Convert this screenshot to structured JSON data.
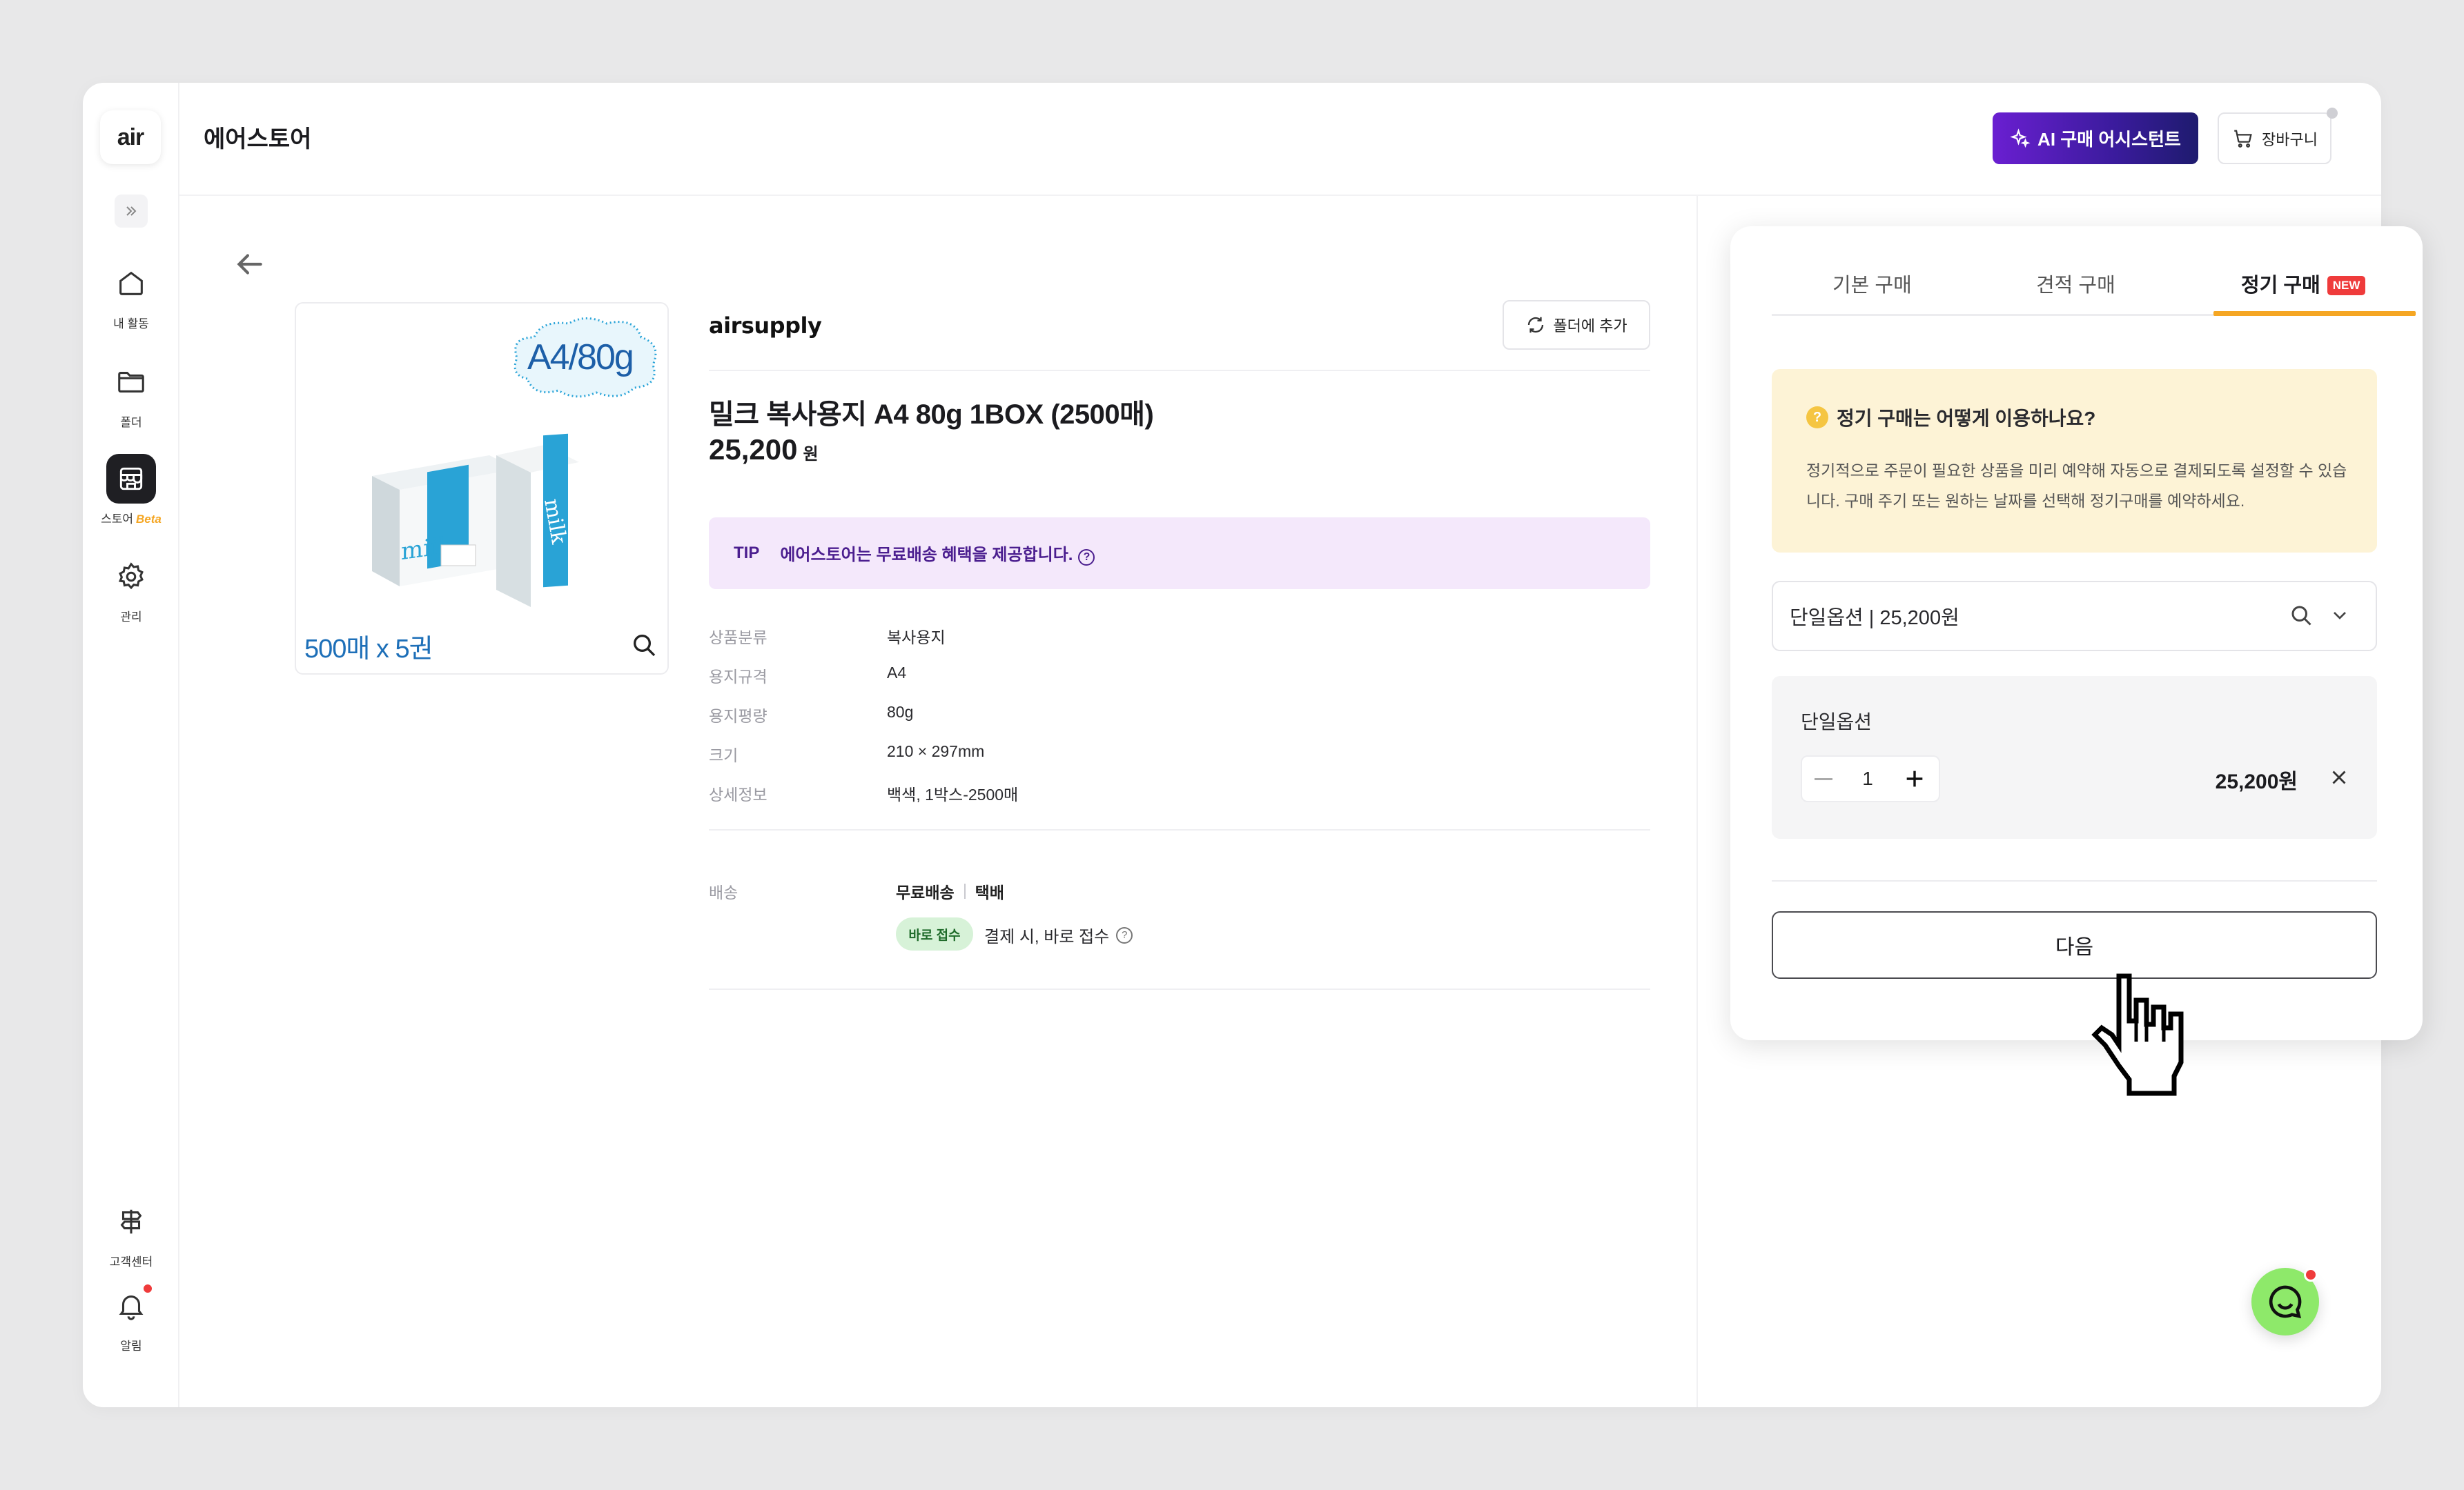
{
  "app": {
    "logo": "air",
    "title": "에어스토어"
  },
  "sidebar": {
    "items": [
      {
        "label": "내 활동",
        "icon": "home-icon"
      },
      {
        "label": "폴더",
        "icon": "folder-icon"
      },
      {
        "label": "스토어",
        "beta": "Beta",
        "icon": "store-icon"
      },
      {
        "label": "관리",
        "icon": "gear-icon"
      }
    ],
    "bottom": [
      {
        "label": "고객센터",
        "icon": "signpost-icon"
      },
      {
        "label": "알림",
        "icon": "bell-icon"
      }
    ]
  },
  "header": {
    "ai_label": "AI 구매 어시스턴트",
    "cart_label": "장바구니"
  },
  "product": {
    "brand": "airsupply",
    "folder_label": "폴더에 추가",
    "image_badge": "A4/80g",
    "image_caption": "500매 x 5권",
    "name": "밀크 복사용지 A4 80g 1BOX (2500매)",
    "price": "25,200",
    "currency": "원",
    "tip_tag": "TIP",
    "tip_text": "에어스토어는 무료배송 혜택을 제공합니다.",
    "specs": [
      {
        "label": "상품분류",
        "value": "복사용지"
      },
      {
        "label": "용지규격",
        "value": "A4"
      },
      {
        "label": "용지평량",
        "value": "80g"
      },
      {
        "label": "크기",
        "value": "210 × 297mm"
      },
      {
        "label": "상세정보",
        "value": "백색, 1박스-2500매"
      }
    ],
    "shipping": {
      "label": "배송",
      "free": "무료배송",
      "method": "택배",
      "badge": "바로 접수",
      "desc": "결제 시, 바로 접수"
    }
  },
  "panel": {
    "tabs": [
      {
        "label": "기본 구매"
      },
      {
        "label": "견적 구매"
      },
      {
        "label": "정기 구매",
        "badge": "NEW"
      }
    ],
    "info_title": "정기 구매는 어떻게 이용하나요?",
    "info_text": "정기적으로 주문이 필요한 상품을 미리 예약해 자동으로 결제되도록 설정할 수 있습니다. 구매 주기 또는 원하는 날짜를 선택해 정기구매를 예약하세요.",
    "select_value": "단일옵션 | 25,200원",
    "option": {
      "title": "단일옵션",
      "qty": "1",
      "price": "25,200원"
    },
    "next_label": "다음"
  },
  "colors": {
    "accent_orange": "#f5a623",
    "ai_purple": "#6a1fd1",
    "tip_bg": "#f4e8fb",
    "info_bg": "#fdf3d6",
    "badge_red": "#ef3b3b",
    "chat_green": "#8ee96a"
  }
}
